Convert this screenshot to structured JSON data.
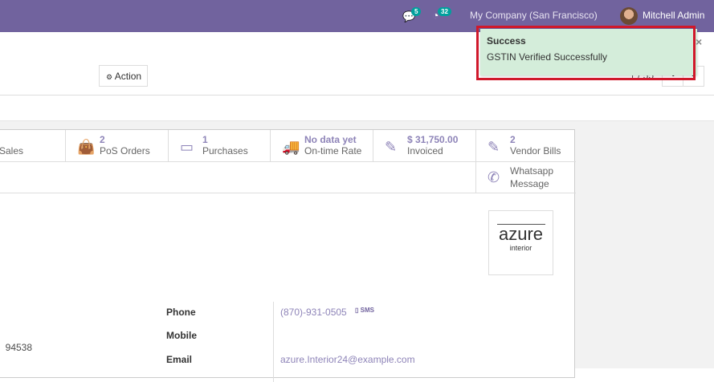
{
  "navbar": {
    "chat_count": "5",
    "activity_count": "32",
    "company": "My Company (San Francisco)",
    "user": "Mitchell Admin",
    "color": "#71639e"
  },
  "control_panel": {
    "action_label": "Action",
    "pager": "1 / 55",
    "prev": "‹",
    "next": "›"
  },
  "toast": {
    "title": "Success",
    "message": "GSTIN Verified Successfully",
    "close": "×"
  },
  "smart_buttons": [
    {
      "value": "",
      "label": "Sales",
      "icon": "dollar-icon"
    },
    {
      "value": "2",
      "label": "PoS Orders",
      "icon": "shopping-bag-icon"
    },
    {
      "value": "1",
      "label": "Purchases",
      "icon": "credit-card-icon"
    },
    {
      "value": "No data yet",
      "label": "On-time Rate",
      "icon": "truck-icon"
    },
    {
      "value": "$ 31,750.00",
      "label": "Invoiced",
      "icon": "pencil-square-icon"
    },
    {
      "value": "2",
      "label": "Vendor Bills",
      "icon": "pencil-square-icon"
    }
  ],
  "whatsapp": {
    "line1": "Whatsapp",
    "line2": "Message"
  },
  "logo": {
    "name": "azure",
    "sub": "interior"
  },
  "address_fragment": ")  94538",
  "fields": {
    "phone_label": "Phone",
    "phone": "(870)-931-0505",
    "sms": "SMS",
    "mobile_label": "Mobile",
    "email_label": "Email",
    "email": "azure.Interior24@example.com"
  }
}
